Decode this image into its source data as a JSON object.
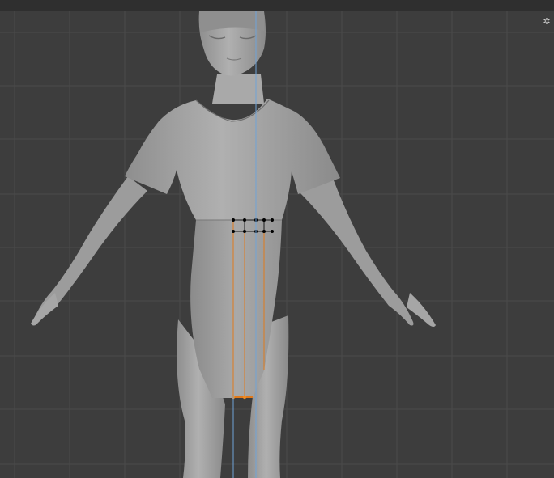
{
  "viewport": {
    "background": "#3d3d3d",
    "grid_color": "#4a4a4a",
    "header_color": "#2f2f2f",
    "model_color": "#a3a3a3",
    "selected_edge_color": "#e07a1c",
    "vertex_color": "#000000",
    "axis_line_color": "#6fa3d8",
    "gizmo_icon": "navigation-gizmo-icon"
  }
}
